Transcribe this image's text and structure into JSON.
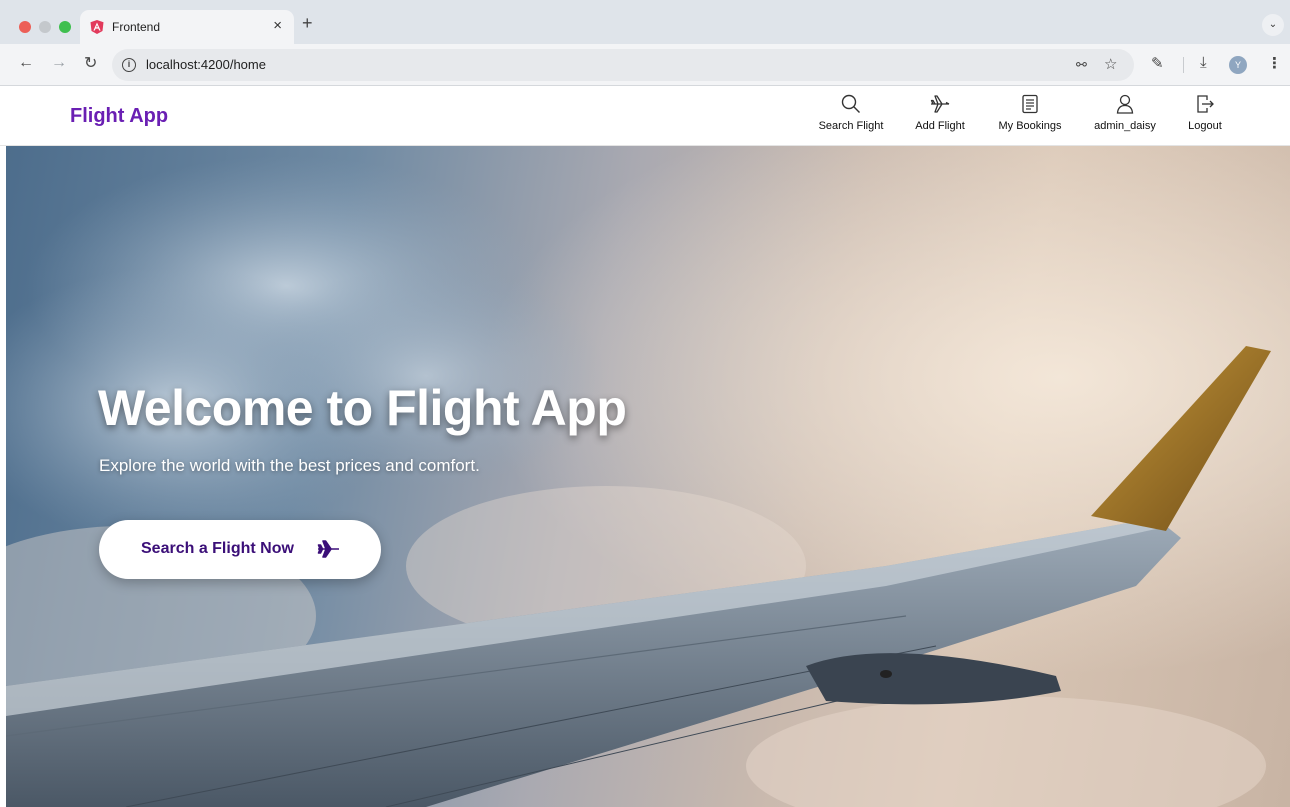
{
  "browser": {
    "tab_title": "Frontend",
    "tab_close": "×",
    "new_tab": "+",
    "url": "localhost:4200/home",
    "profile_initial": "Y",
    "icons": [
      "back-icon",
      "forward-icon",
      "reload-icon",
      "info-icon",
      "key-icon",
      "star-icon",
      "extensions-icon",
      "download-icon",
      "more-icon"
    ]
  },
  "navbar": {
    "brand": "Flight App",
    "items": [
      {
        "label": "Search Flight",
        "icon": "search-icon"
      },
      {
        "label": "Add Flight",
        "icon": "plane-icon"
      },
      {
        "label": "My Bookings",
        "icon": "bookings-icon"
      },
      {
        "label": "admin_daisy",
        "icon": "user-icon"
      },
      {
        "label": "Logout",
        "icon": "logout-icon"
      }
    ]
  },
  "hero": {
    "title": "Welcome to Flight App",
    "subtitle": "Explore the world with the best prices and comfort.",
    "cta_label": "Search a Flight Now",
    "cta_icon": "plane-icon"
  },
  "colors": {
    "brand": "#6a1fb3",
    "cta_text": "#3b0f78"
  }
}
